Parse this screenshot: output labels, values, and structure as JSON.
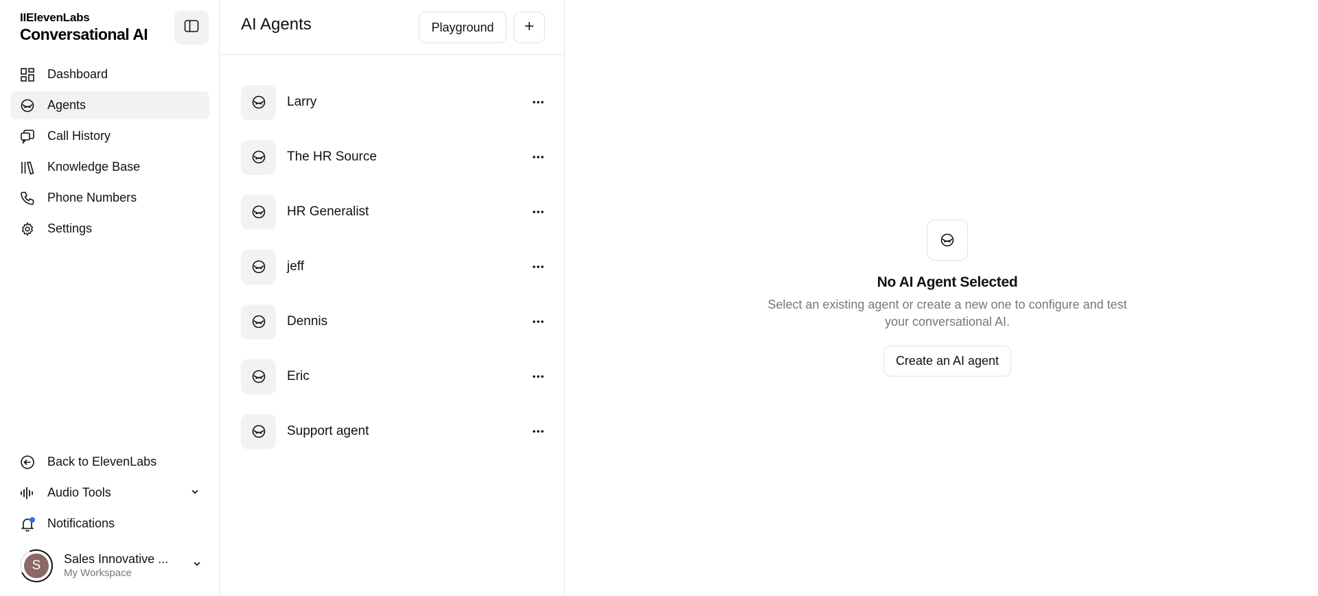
{
  "brand": {
    "top": "IIElevenLabs",
    "product": "Conversational AI"
  },
  "sidebar": {
    "items": [
      {
        "label": "Dashboard",
        "icon": "dashboard-icon",
        "active": false
      },
      {
        "label": "Agents",
        "icon": "agent-icon",
        "active": true
      },
      {
        "label": "Call History",
        "icon": "chat-bubbles-icon",
        "active": false
      },
      {
        "label": "Knowledge Base",
        "icon": "books-icon",
        "active": false
      },
      {
        "label": "Phone Numbers",
        "icon": "phone-icon",
        "active": false
      },
      {
        "label": "Settings",
        "icon": "gear-icon",
        "active": false
      }
    ],
    "bottom": {
      "back": "Back to ElevenLabs",
      "audio_tools": "Audio Tools",
      "notifications": "Notifications"
    },
    "workspace": {
      "avatar_letter": "S",
      "name": "Sales Innovative ...",
      "subtitle": "My Workspace"
    }
  },
  "list": {
    "title": "AI Agents",
    "playground_label": "Playground",
    "agents": [
      {
        "name": "Larry"
      },
      {
        "name": "The HR Source"
      },
      {
        "name": "HR Generalist"
      },
      {
        "name": "jeff"
      },
      {
        "name": "Dennis"
      },
      {
        "name": "Eric"
      },
      {
        "name": "Support agent"
      }
    ]
  },
  "empty_state": {
    "title": "No AI Agent Selected",
    "description": "Select an existing agent or create a new one to configure and test your conversational AI.",
    "button_label": "Create an AI agent"
  },
  "colors": {
    "active_bg": "#f2f2f2",
    "border": "#e5e5e5",
    "notification_dot": "#2f6fed",
    "avatar_bg": "#8a6a62"
  }
}
